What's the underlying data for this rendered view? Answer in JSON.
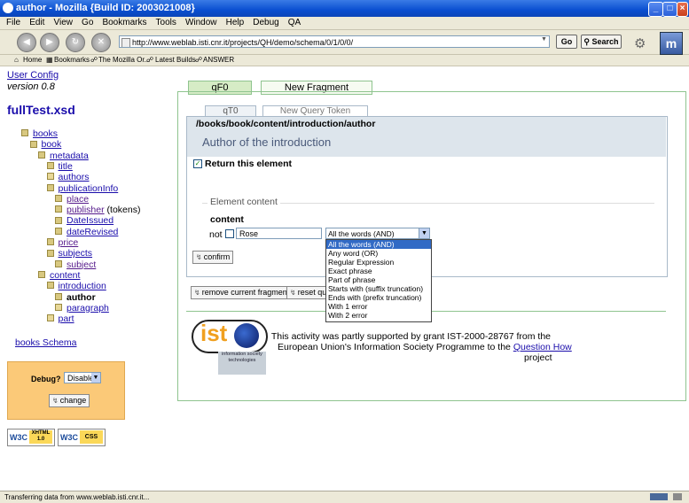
{
  "window": {
    "title": "author - Mozilla {Build ID: 2003021008}",
    "minimize": "_",
    "maximize": "□",
    "close": "×"
  },
  "menu": [
    "File",
    "Edit",
    "View",
    "Go",
    "Bookmarks",
    "Tools",
    "Window",
    "Help",
    "Debug",
    "QA"
  ],
  "nav": {
    "url": "http://www.weblab.isti.cnr.it/projects/QH/demo/schema/0/1/0/0/",
    "go_label": "Go",
    "search_label": "Search"
  },
  "bookmarks": [
    "Home",
    "Bookmarks",
    "The Mozilla Or...",
    "Latest Builds",
    "ANSWER"
  ],
  "sidebar": {
    "user_config": "User Config",
    "version": "version 0.8",
    "file_title": "fullTest.xsd",
    "tree": [
      {
        "label": "books",
        "indent": 0,
        "box": "minus",
        "style": "link"
      },
      {
        "label": "book",
        "indent": 1,
        "box": "minus",
        "style": "link"
      },
      {
        "label": "metadata",
        "indent": 2,
        "box": "minus",
        "style": "link"
      },
      {
        "label": "title",
        "indent": 3,
        "box": "leaf",
        "style": "link"
      },
      {
        "label": "authors",
        "indent": 3,
        "box": "plus",
        "style": "link"
      },
      {
        "label": "publicationInfo",
        "indent": 3,
        "box": "minus",
        "style": "link"
      },
      {
        "label": "place",
        "indent": 4,
        "box": "leaf",
        "style": "visited"
      },
      {
        "label": "publisher",
        "suffix": " (tokens)",
        "indent": 4,
        "box": "leaf",
        "style": "visited"
      },
      {
        "label": "DateIssued",
        "indent": 4,
        "box": "leaf",
        "style": "link"
      },
      {
        "label": "dateRevised",
        "indent": 4,
        "box": "leaf",
        "style": "link"
      },
      {
        "label": "price",
        "indent": 3,
        "box": "leaf",
        "style": "visited"
      },
      {
        "label": "subjects",
        "indent": 3,
        "box": "minus",
        "style": "link"
      },
      {
        "label": "subject",
        "indent": 4,
        "box": "leaf",
        "style": "visited"
      },
      {
        "label": "content",
        "indent": 2,
        "box": "minus",
        "style": "link"
      },
      {
        "label": "introduction",
        "indent": 3,
        "box": "minus",
        "style": "link"
      },
      {
        "label": "author",
        "indent": 4,
        "box": "leaf",
        "style": "bold"
      },
      {
        "label": "paragraph",
        "indent": 4,
        "box": "plus",
        "style": "link"
      },
      {
        "label": "part",
        "indent": 3,
        "box": "plus",
        "style": "link"
      }
    ],
    "schema_link": "books Schema",
    "debug_label": "Debug?",
    "debug_value": "Disable",
    "change_label": "change",
    "badge_xhtml": "XHTML 1.0",
    "badge_css": "CSS"
  },
  "main": {
    "tab_active": "qF0",
    "tab_new": "New Fragment",
    "subtab_active": "qT0",
    "subtab_new": "New Query Token",
    "path": "/books/book/content/introduction/author",
    "heading": "Author of the introduction",
    "return_label": "Return this element",
    "section_legend": "Element content",
    "field_label": "content",
    "not_label": "not",
    "input_value": "Rose",
    "select_value": "All the words (AND)",
    "select_options": [
      "All the words (AND)",
      "Any word (OR)",
      "Regular Expression",
      "Exact phrase",
      "Part of phrase",
      "Starts with (suffix truncation)",
      "Ends with (prefix truncation)",
      "With 1 error",
      "With 2 error"
    ],
    "confirm_label": "confirm",
    "remove_label": "remove current fragment",
    "reset_label": "reset que",
    "ist_logo": "ist",
    "ist_caption": "information society technologies",
    "footer_line1": "This activity was partly supported by grant IST-2000-28767 from the",
    "footer_line2": "European Union's Information Society Programme to the",
    "footer_link": "Question How",
    "footer_line3": "project"
  },
  "status": {
    "text": "Transferring data from www.weblab.isti.cnr.it..."
  },
  "colors": {
    "tab_green": "#d6ecc6",
    "border_green": "#8fc48f",
    "path_bg": "#dde5ec",
    "heading_color": "#4a5a7a",
    "debug_bg": "#fbc978"
  }
}
